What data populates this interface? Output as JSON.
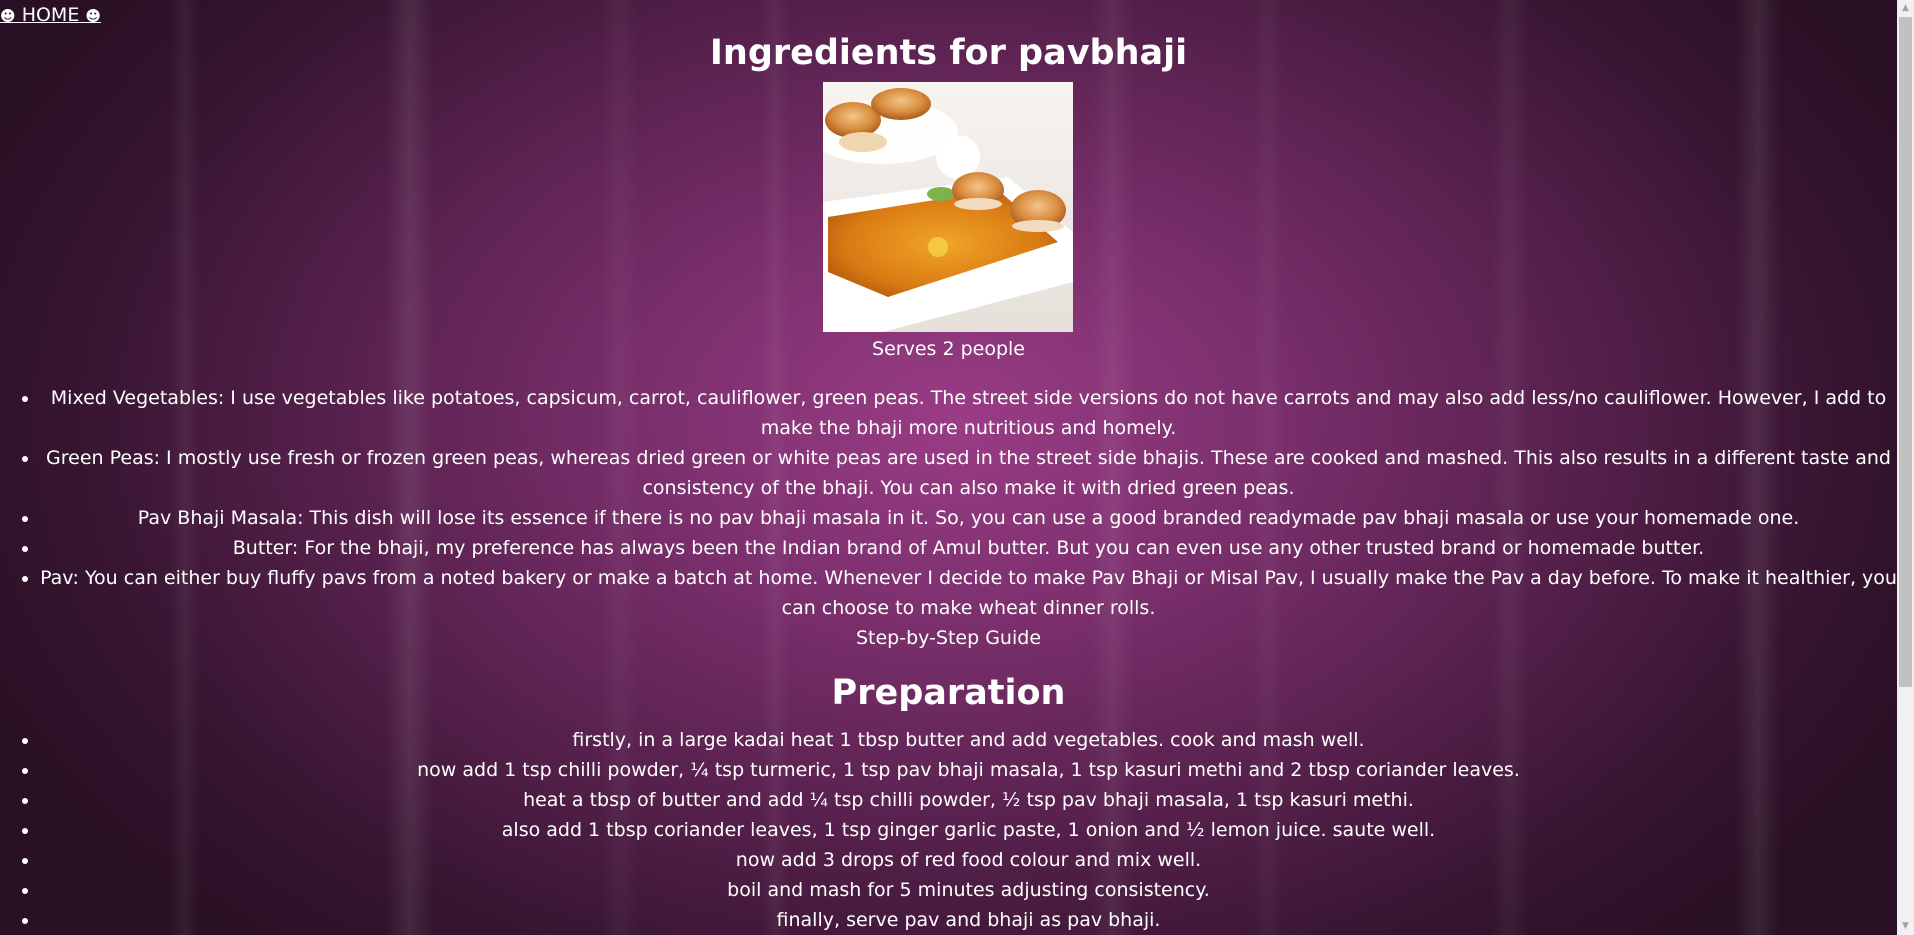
{
  "nav": {
    "home_label": "HOME",
    "home_icon_left": "☻",
    "home_icon_right": "☻"
  },
  "page": {
    "title": "Ingredients for pavbhaji",
    "serves": "Serves 2 people"
  },
  "ingredients": [
    "Mixed Vegetables: I use vegetables like potatoes, capsicum, carrot, cauliflower, green peas. The street side versions do not have carrots and may also add less/no cauliflower. However, I add to make the bhaji more nutritious and homely.",
    "Green Peas: I mostly use fresh or frozen green peas, whereas dried green or white peas are used in the street side bhajis. These are cooked and mashed. This also results in a different taste and consistency of the bhaji. You can also make it with dried green peas.",
    "Pav Bhaji Masala: This dish will lose its essence if there is no pav bhaji masala in it. So, you can use a good branded readymade pav bhaji masala or use your homemade one.",
    "Butter: For the bhaji, my preference has always been the Indian brand of Amul butter. But you can even use any other trusted brand or homemade butter.",
    "Pav: You can either buy fluffy pavs from a noted bakery or make a batch at home. Whenever I decide to make Pav Bhaji or Misal Pav, I usually make the Pav a day before. To make it healthier, you can choose to make wheat dinner rolls."
  ],
  "guide_label": "Step-by-Step Guide",
  "preparation": {
    "heading": "Preparation",
    "steps": [
      "firstly, in a large kadai heat 1 tbsp butter and add vegetables. cook and mash well.",
      "now add 1 tsp chilli powder, ¼ tsp turmeric, 1 tsp pav bhaji masala, 1 tsp kasuri methi and 2 tbsp coriander leaves.",
      "heat a tbsp of butter and add ¼ tsp chilli powder, ½ tsp pav bhaji masala, 1 tsp kasuri methi.",
      "also add 1 tbsp coriander leaves, 1 tsp ginger garlic paste, 1 onion and ½ lemon juice. saute well.",
      "now add 3 drops of red food colour and mix well.",
      "boil and mash for 5 minutes adjusting consistency.",
      "finally, serve pav and bhaji as pav bhaji."
    ]
  },
  "colors": {
    "background_center": "#9a3c86",
    "background_edge": "#2a1025",
    "text": "#ffffff"
  }
}
